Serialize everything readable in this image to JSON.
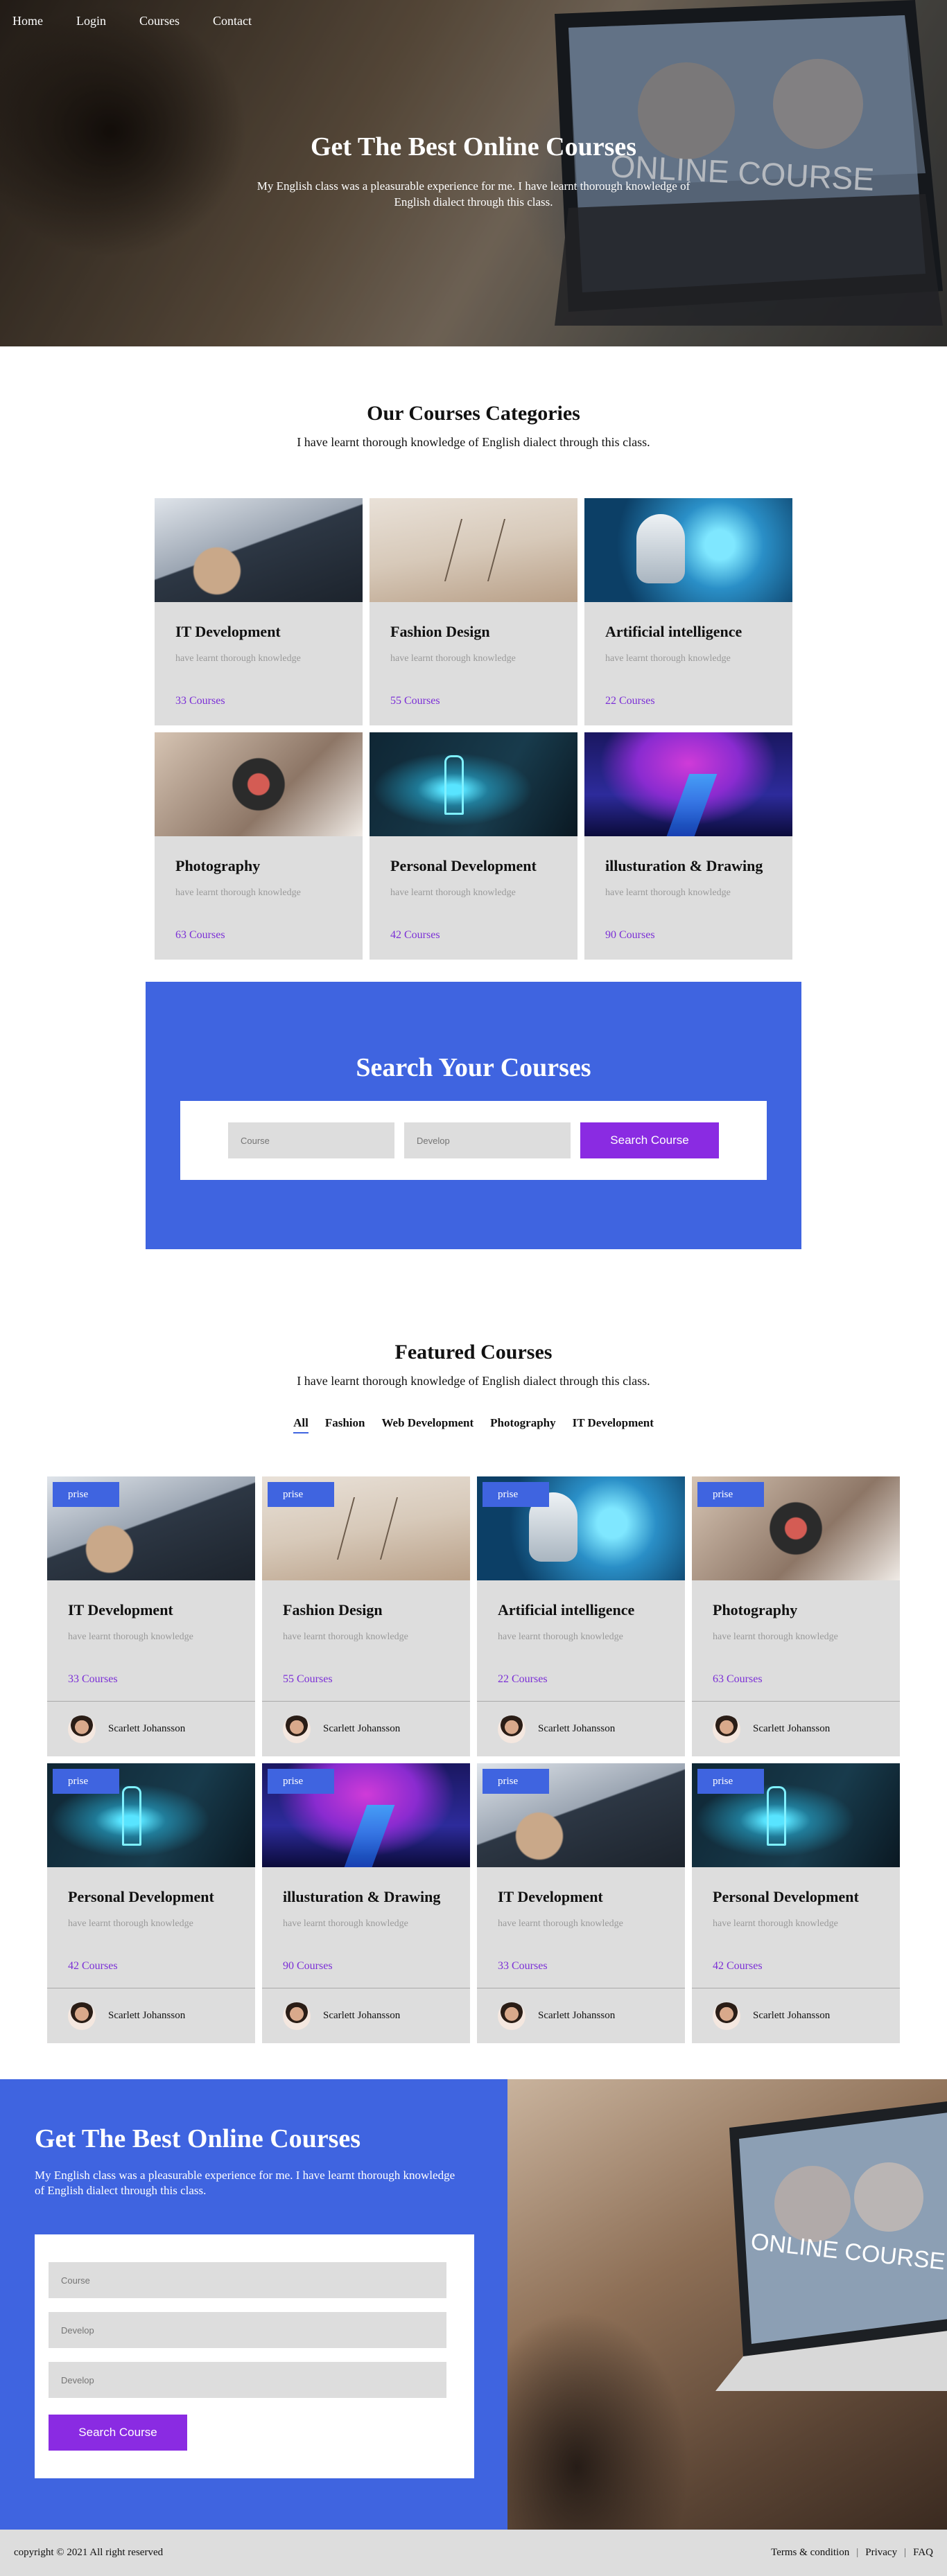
{
  "nav": {
    "items": [
      "Home",
      "Login",
      "Courses",
      "Contact"
    ]
  },
  "hero": {
    "title": "Get The Best Online Courses",
    "text": "My English class was a pleasurable experience for me. I have learnt thorough knowledge of English dialect through this class.",
    "laptop_text": "ONLINE COURSE"
  },
  "categories": {
    "title": "Our Courses Categories",
    "subtitle": "I have learnt thorough knowledge of English dialect through this class.",
    "items": [
      {
        "title": "IT Development",
        "sub": "have learnt thorough knowledge",
        "count": "33 Courses",
        "thumb": "th-it"
      },
      {
        "title": "Fashion Design",
        "sub": "have learnt thorough knowledge",
        "count": "55 Courses",
        "thumb": "th-fashion"
      },
      {
        "title": "Artificial intelligence",
        "sub": "have learnt thorough knowledge",
        "count": "22 Courses",
        "thumb": "th-ai"
      },
      {
        "title": "Photography",
        "sub": "have learnt thorough knowledge",
        "count": "63 Courses",
        "thumb": "th-photo"
      },
      {
        "title": "Personal Development",
        "sub": "have learnt thorough knowledge",
        "count": "42 Courses",
        "thumb": "th-personal"
      },
      {
        "title": "illusturation & Drawing",
        "sub": "have learnt thorough knowledge",
        "count": "90 Courses",
        "thumb": "th-illus"
      }
    ]
  },
  "search": {
    "title": "Search Your Courses",
    "course_placeholder": "Course",
    "develop_placeholder": "Develop",
    "button": "Search Course"
  },
  "featured": {
    "title": "Featured Courses",
    "subtitle": "I have learnt thorough knowledge of English dialect through this class.",
    "tabs": [
      "All",
      "Fashion",
      "Web Development",
      "Photography",
      "IT Development"
    ],
    "active_tab": "All",
    "badge": "prise",
    "author": "Scarlett Johansson",
    "items": [
      {
        "title": "IT Development",
        "sub": "have learnt thorough knowledge",
        "count": "33 Courses",
        "thumb": "th-it"
      },
      {
        "title": "Fashion Design",
        "sub": "have learnt thorough knowledge",
        "count": "55 Courses",
        "thumb": "th-fashion"
      },
      {
        "title": "Artificial intelligence",
        "sub": "have learnt thorough knowledge",
        "count": "22 Courses",
        "thumb": "th-ai"
      },
      {
        "title": "Photography",
        "sub": "have learnt thorough knowledge",
        "count": "63 Courses",
        "thumb": "th-photo"
      },
      {
        "title": "Personal Development",
        "sub": "have learnt thorough knowledge",
        "count": "42 Courses",
        "thumb": "th-personal"
      },
      {
        "title": "illusturation & Drawing",
        "sub": "have learnt thorough knowledge",
        "count": "90 Courses",
        "thumb": "th-illus"
      },
      {
        "title": "IT Development",
        "sub": "have learnt thorough knowledge",
        "count": "33 Courses",
        "thumb": "th-it"
      },
      {
        "title": "Personal Development",
        "sub": "have learnt thorough knowledge",
        "count": "42 Courses",
        "thumb": "th-personal"
      }
    ]
  },
  "cta": {
    "title": "Get The Best Online Courses",
    "text": "My English class was a pleasurable experience for me. I have learnt thorough knowledge of English dialect through this class.",
    "placeholders": [
      "Course",
      "Develop",
      "Develop"
    ],
    "button": "Search Course",
    "laptop_text": "ONLINE COURSE"
  },
  "footer": {
    "copyright": "copyright © 2021 All right reserved",
    "links": [
      "Terms & condition",
      "Privacy",
      "FAQ"
    ]
  },
  "colors": {
    "primary": "#3f64e0",
    "accent": "#8a2be2",
    "card": "#dddddd",
    "count": "#7b2fd6"
  }
}
